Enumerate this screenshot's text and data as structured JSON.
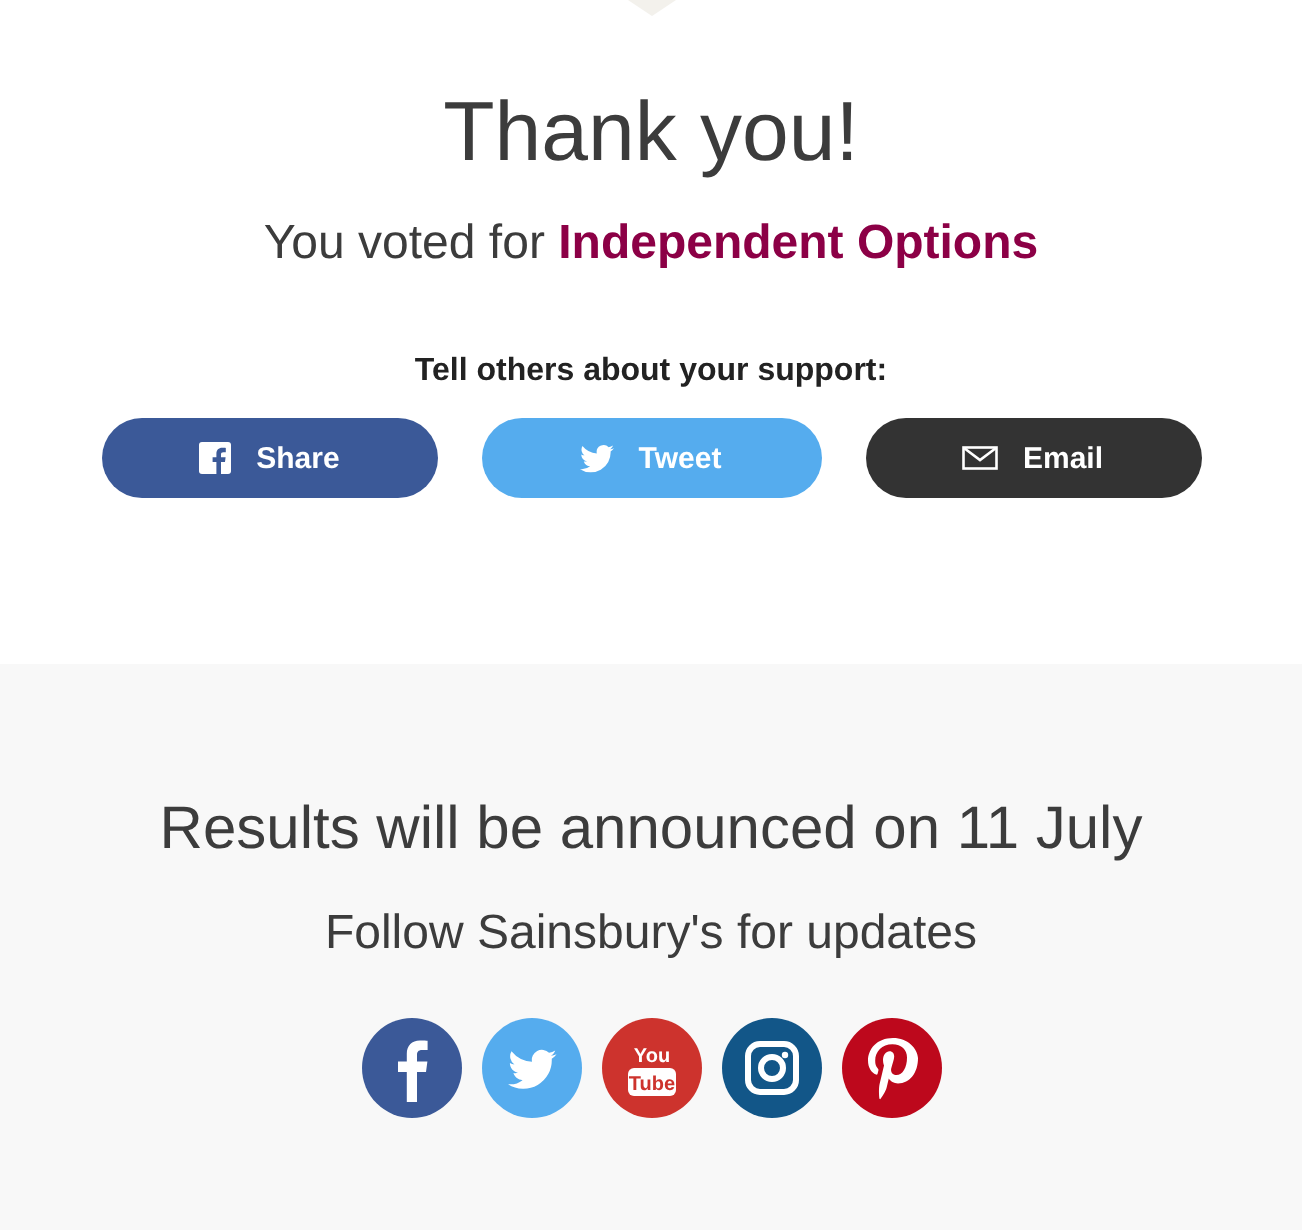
{
  "heading": "Thank you!",
  "vote": "You voted for **Independent Options**",
  "share": {
    "prompt": "Tell others about your support:",
    "buttons": [
      {
        "kind": "facebook",
        "label": "Share"
      },
      {
        "kind": "twitter",
        "label": "Tweet"
      },
      {
        "kind": "email",
        "label": "Email"
      }
    ]
  },
  "results": {
    "title": "Results will be announced on 11 July",
    "subtitle": "Follow Sainsbury's for updates",
    "follow_icons": [
      {
        "kind": "facebook"
      },
      {
        "kind": "twitter"
      },
      {
        "kind": "youtube",
        "lines": [
          "You",
          "Tube"
        ]
      },
      {
        "kind": "instagram"
      },
      {
        "kind": "pinterest"
      }
    ]
  }
}
